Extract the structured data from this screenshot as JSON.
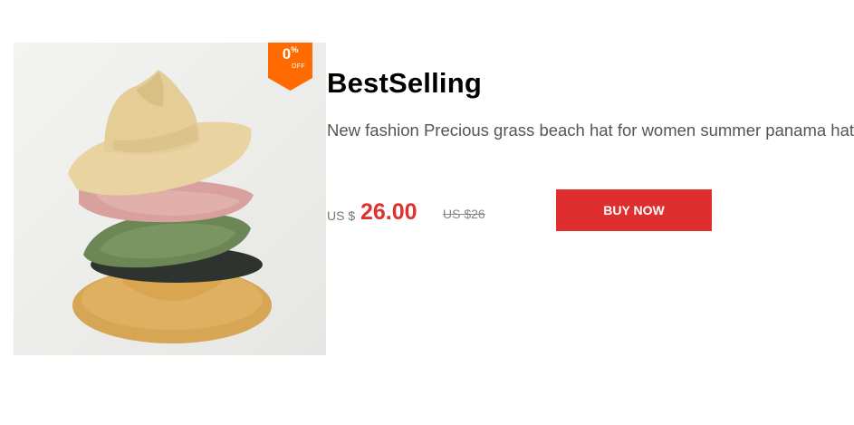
{
  "product": {
    "badge": {
      "value": "0",
      "percent": "%",
      "off": "OFF",
      "color": "#ff6b00"
    },
    "title": "BestSelling",
    "description": "New fashion Precious grass beach hat for women summer panama hat straw beach sun hat for lady holiday",
    "price": {
      "currency_label": "US $",
      "current": "26.00",
      "original": "US $26",
      "color": "#e03131"
    },
    "buy_button": {
      "label": "BUY NOW",
      "color": "#e02d2d"
    },
    "image": {
      "subject": "stacked straw hats",
      "hat_colors": [
        "#e9d5a5",
        "#dba8a3",
        "#6f8a58",
        "#333333",
        "#d9a957"
      ]
    }
  }
}
